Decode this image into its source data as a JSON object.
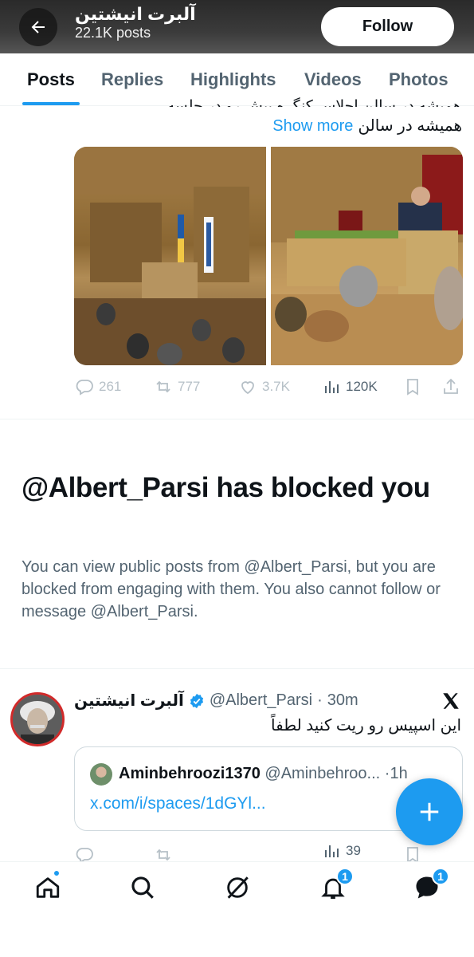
{
  "header": {
    "display_name": "آلبرت انیشتین",
    "post_count": "22.1K posts",
    "follow_label": "Follow"
  },
  "tabs": [
    {
      "label": "Posts",
      "active": true
    },
    {
      "label": "Replies"
    },
    {
      "label": "Highlights"
    },
    {
      "label": "Videos"
    },
    {
      "label": "Photos"
    }
  ],
  "post1": {
    "cut_text": "همیشه در سالن اجلاس کنگره پیش رو در جلسه",
    "line2_text": "همیشه در سالن",
    "show_more": "Show more",
    "stats": {
      "replies": "261",
      "reposts": "777",
      "likes": "3.7K",
      "views": "120K"
    }
  },
  "blocked": {
    "title": "@Albert_Parsi has blocked you",
    "description": "You can view public posts from @Albert_Parsi, but you are blocked from engaging with them. You also cannot follow or message @Albert_Parsi."
  },
  "post2": {
    "author_name": "آلبرت انیشتین",
    "handle": "@Albert_Parsi",
    "separator": "·",
    "time": "30m",
    "text": "این اسپیس رو ریت کنید لطفاً",
    "quote": {
      "author_name": "Aminbehroozi1370",
      "handle": "@Aminbehroo...",
      "time": "1h",
      "link": "x.com/i/spaces/1dGYl..."
    },
    "stats": {
      "views": "39"
    }
  },
  "nav": {
    "notifications_badge": "1",
    "messages_badge": "1"
  },
  "colors": {
    "accent": "#1d9bf0",
    "text": "#0f1419",
    "secondary": "#536471"
  }
}
